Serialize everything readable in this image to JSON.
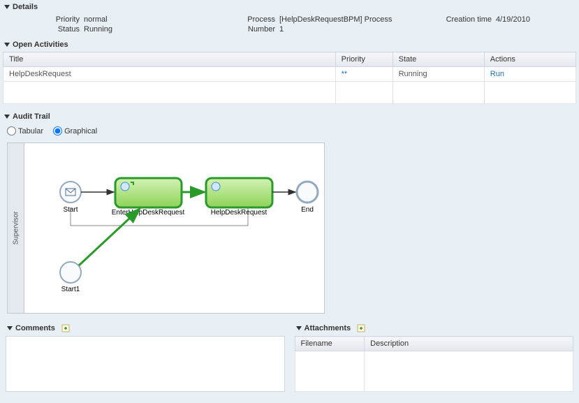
{
  "details": {
    "header": "Details",
    "priority_label": "Priority",
    "priority": "normal",
    "status_label": "Status",
    "status": "Running",
    "process_label": "Process",
    "process": "[HelpDeskRequestBPM] Process",
    "number_label": "Number",
    "number": "1",
    "creation_label": "Creation time",
    "creation": "4/19/2010"
  },
  "open_activities": {
    "header": "Open Activities",
    "columns": {
      "title": "Title",
      "priority": "Priority",
      "state": "State",
      "actions": "Actions"
    },
    "row": {
      "title": "HelpDeskRequest",
      "priority": "**",
      "state": "Running",
      "action": "Run"
    }
  },
  "audit_trail": {
    "header": "Audit Trail",
    "radio_tabular": "Tabular",
    "radio_graphical": "Graphical",
    "swimlane": "Supervisor",
    "nodes": {
      "start": "Start",
      "enter": "EnterHelpDeskRequest",
      "help": "HelpDeskRequest",
      "end": "End",
      "start1": "Start1"
    }
  },
  "comments": {
    "header": "Comments"
  },
  "attachments": {
    "header": "Attachments",
    "columns": {
      "filename": "Filename",
      "description": "Description"
    }
  }
}
